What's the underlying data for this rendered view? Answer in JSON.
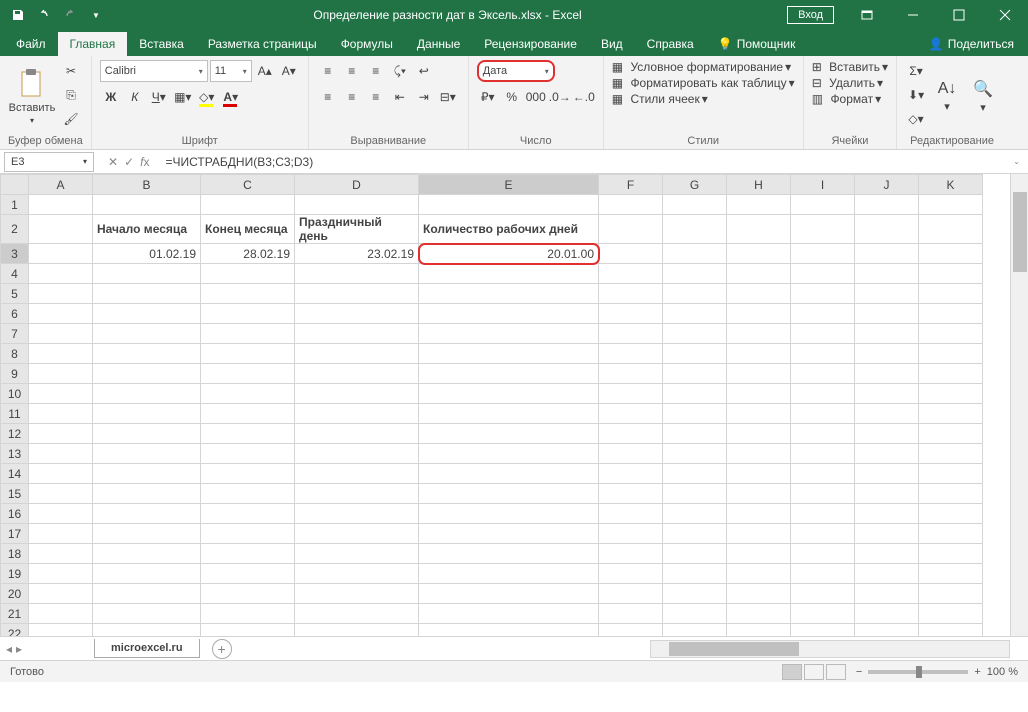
{
  "titlebar": {
    "title": "Определение разности дат в Эксель.xlsx  -  Excel",
    "login": "Вход"
  },
  "tabs": {
    "file": "Файл",
    "home": "Главная",
    "insert": "Вставка",
    "layout": "Разметка страницы",
    "formulas": "Формулы",
    "data": "Данные",
    "review": "Рецензирование",
    "view": "Вид",
    "help": "Справка",
    "tell": "Помощник",
    "share": "Поделиться"
  },
  "ribbon": {
    "clipboard": {
      "label": "Буфер обмена",
      "paste": "Вставить"
    },
    "font": {
      "label": "Шрифт",
      "name": "Calibri",
      "size": "11"
    },
    "align": {
      "label": "Выравнивание"
    },
    "number": {
      "label": "Число",
      "format": "Дата"
    },
    "styles": {
      "label": "Стили",
      "cond": "Условное форматирование",
      "table": "Форматировать как таблицу",
      "cell": "Стили ячеек"
    },
    "cells": {
      "label": "Ячейки",
      "insert": "Вставить",
      "delete": "Удалить",
      "format": "Формат"
    },
    "editing": {
      "label": "Редактирование"
    }
  },
  "namebox": "E3",
  "formula": "=ЧИСТРАБДНИ(B3;C3;D3)",
  "columns": [
    "A",
    "B",
    "C",
    "D",
    "E",
    "F",
    "G",
    "H",
    "I",
    "J",
    "K"
  ],
  "rows": [
    "1",
    "2",
    "3",
    "4",
    "5",
    "6",
    "7",
    "8",
    "9",
    "10",
    "11",
    "12",
    "13",
    "14",
    "15",
    "16",
    "17",
    "18",
    "19",
    "20",
    "21",
    "22"
  ],
  "headers": {
    "b2": "Начало месяца",
    "c2": "Конец месяца",
    "d2": "Праздничный день",
    "e2": "Количество рабочих дней"
  },
  "values": {
    "b3": "01.02.19",
    "c3": "28.02.19",
    "d3": "23.02.19",
    "e3": "20.01.00"
  },
  "sheet": {
    "name": "microexcel.ru"
  },
  "status": {
    "ready": "Готово",
    "zoom": "100 %"
  },
  "colwidths": {
    "A": 64,
    "B": 108,
    "C": 94,
    "D": 124,
    "E": 180,
    "F": 64,
    "G": 64,
    "H": 64,
    "I": 64,
    "J": 64,
    "K": 64
  }
}
